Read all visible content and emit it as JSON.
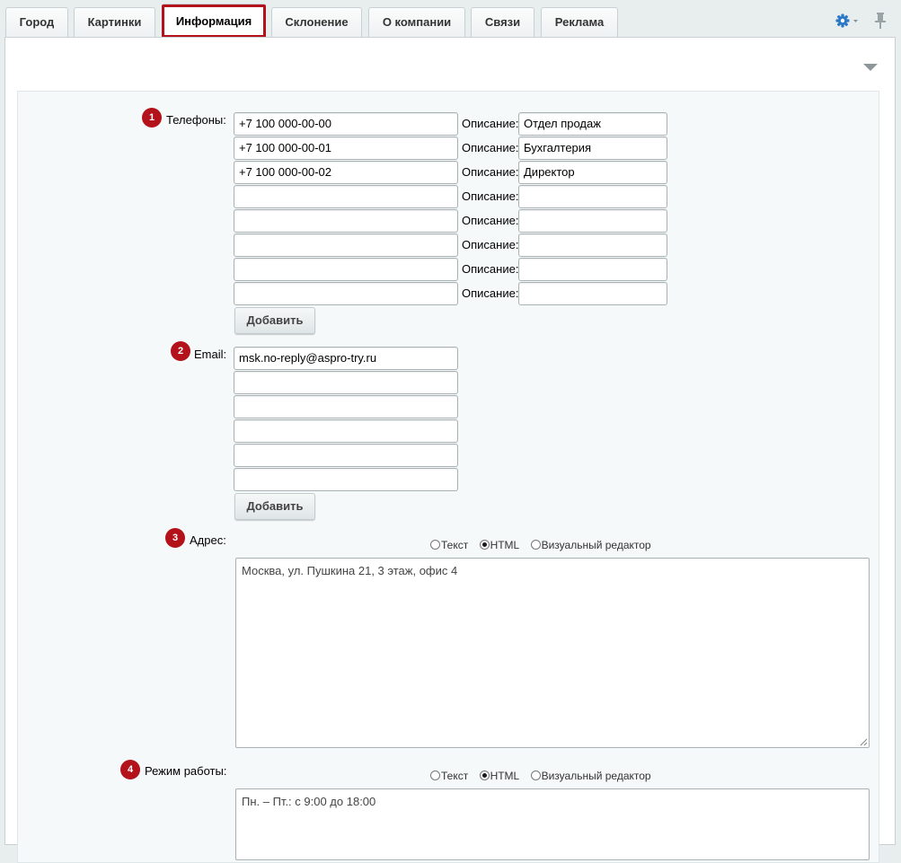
{
  "tabs": [
    {
      "label": "Город"
    },
    {
      "label": "Картинки"
    },
    {
      "label": "Информация"
    },
    {
      "label": "Склонение"
    },
    {
      "label": "О компании"
    },
    {
      "label": "Связи"
    },
    {
      "label": "Реклама"
    }
  ],
  "active_tab": "Информация",
  "icons": {
    "settings": "gear-icon",
    "pin": "pin-icon",
    "collapse": "triangle-down-icon"
  },
  "colors": {
    "badge": "#b3121b",
    "highlight_outline": "#b3121b",
    "gear": "#2a78c6"
  },
  "phones": {
    "badge": "1",
    "label": "Телефоны:",
    "description_label": "Описание:",
    "rows": [
      {
        "phone": "+7 100 000-00-00",
        "description": "Отдел продаж"
      },
      {
        "phone": "+7 100 000-00-01",
        "description": "Бухгалтерия"
      },
      {
        "phone": "+7 100 000-00-02",
        "description": "Директор"
      },
      {
        "phone": "",
        "description": ""
      },
      {
        "phone": "",
        "description": ""
      },
      {
        "phone": "",
        "description": ""
      },
      {
        "phone": "",
        "description": ""
      },
      {
        "phone": "",
        "description": ""
      }
    ],
    "add_label": "Добавить"
  },
  "email": {
    "badge": "2",
    "label": "Email:",
    "rows": [
      "msk.no-reply@aspro-try.ru",
      "",
      "",
      "",
      "",
      ""
    ],
    "add_label": "Добавить"
  },
  "address": {
    "badge": "3",
    "label": "Адрес:",
    "modes": [
      "Текст",
      "HTML",
      "Визуальный редактор"
    ],
    "selected_mode": "HTML",
    "value": "Москва, ул. Пушкина 21, 3 этаж, офис 4"
  },
  "schedule": {
    "badge": "4",
    "label": "Режим работы:",
    "modes": [
      "Текст",
      "HTML",
      "Визуальный редактор"
    ],
    "selected_mode": "HTML",
    "value": "Пн. – Пт.: с 9:00 до 18:00"
  }
}
